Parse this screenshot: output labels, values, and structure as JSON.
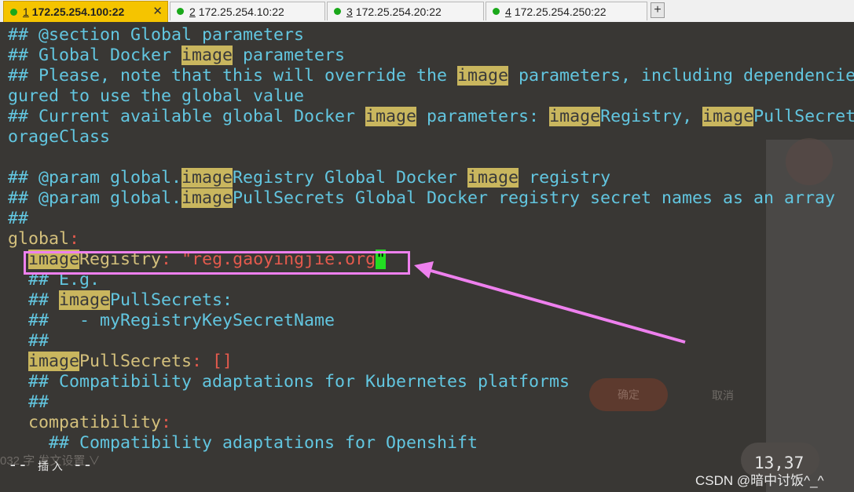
{
  "tabs": [
    {
      "num": "1",
      "label": "172.25.254.100:22",
      "active": true,
      "close": "✕"
    },
    {
      "num": "2",
      "label": "172.25.254.10:22",
      "active": false
    },
    {
      "num": "3",
      "label": "172.25.254.20:22",
      "active": false
    },
    {
      "num": "4",
      "label": "172.25.254.250:22",
      "active": false
    }
  ],
  "add_tab": "+",
  "terminal": {
    "lines": [
      [
        {
          "t": "## @section Global parameters",
          "c": "c"
        }
      ],
      [
        {
          "t": "## Global Docker ",
          "c": "c"
        },
        {
          "t": "image",
          "c": "hl"
        },
        {
          "t": " parameters",
          "c": "c"
        }
      ],
      [
        {
          "t": "## Please, note that this will override the ",
          "c": "c"
        },
        {
          "t": "image",
          "c": "hl"
        },
        {
          "t": " parameters, including dependencie",
          "c": "c"
        }
      ],
      [
        {
          "t": "gured to use the global value",
          "c": "c"
        }
      ],
      [
        {
          "t": "## Current available global Docker ",
          "c": "c"
        },
        {
          "t": "image",
          "c": "hl"
        },
        {
          "t": " parameters: ",
          "c": "c"
        },
        {
          "t": "image",
          "c": "hl"
        },
        {
          "t": "Registry, ",
          "c": "c"
        },
        {
          "t": "image",
          "c": "hl"
        },
        {
          "t": "PullSecret",
          "c": "c"
        }
      ],
      [
        {
          "t": "orageClass",
          "c": "c"
        }
      ],
      [],
      [
        {
          "t": "## @param global.",
          "c": "c"
        },
        {
          "t": "image",
          "c": "hl"
        },
        {
          "t": "Registry Global Docker ",
          "c": "c"
        },
        {
          "t": "image",
          "c": "hl"
        },
        {
          "t": " registry",
          "c": "c"
        }
      ],
      [
        {
          "t": "## @param global.",
          "c": "c"
        },
        {
          "t": "image",
          "c": "hl"
        },
        {
          "t": "PullSecrets Global Docker registry secret names as an array",
          "c": "c"
        }
      ],
      [
        {
          "t": "##",
          "c": "c"
        }
      ],
      [
        {
          "t": "global",
          "c": "y"
        },
        {
          "t": ":",
          "c": "s"
        }
      ],
      [
        {
          "t": "  "
        },
        {
          "t": "image",
          "c": "hl"
        },
        {
          "t": "Registry",
          "c": "y"
        },
        {
          "t": ": ",
          "c": "s"
        },
        {
          "t": "\"reg.gaoyingjie.org",
          "c": "s"
        },
        {
          "t": "\"",
          "c": "cur"
        }
      ],
      [
        {
          "t": "  "
        },
        {
          "t": "## E.g.",
          "c": "c"
        }
      ],
      [
        {
          "t": "  "
        },
        {
          "t": "## ",
          "c": "c"
        },
        {
          "t": "image",
          "c": "hl"
        },
        {
          "t": "PullSecrets:",
          "c": "c"
        }
      ],
      [
        {
          "t": "  "
        },
        {
          "t": "##   - myRegistryKeySecretName",
          "c": "c"
        }
      ],
      [
        {
          "t": "  "
        },
        {
          "t": "##",
          "c": "c"
        }
      ],
      [
        {
          "t": "  "
        },
        {
          "t": "image",
          "c": "hl"
        },
        {
          "t": "PullSecrets",
          "c": "y"
        },
        {
          "t": ": []",
          "c": "s"
        }
      ],
      [
        {
          "t": "  "
        },
        {
          "t": "## Compatibility adaptations for Kubernetes platforms",
          "c": "c"
        }
      ],
      [
        {
          "t": "  "
        },
        {
          "t": "##",
          "c": "c"
        }
      ],
      [
        {
          "t": "  "
        },
        {
          "t": "compatibility",
          "c": "y"
        },
        {
          "t": ":",
          "c": "s"
        }
      ],
      [
        {
          "t": "    "
        },
        {
          "t": "## Compatibility adaptations for Openshift",
          "c": "c"
        }
      ]
    ]
  },
  "status": {
    "prefix": "-- ",
    "mode": "插 入",
    "suffix": " --",
    "position": "13,37"
  },
  "background_ghost": {
    "confirm": "确定",
    "cancel": "取消",
    "bottom": "032 字   发文设置 ∨"
  },
  "watermark": "CSDN @暗中讨饭^_^",
  "colors": {
    "tab_active": "#f5c400",
    "comment": "#62c6e0",
    "key": "#d4c07c",
    "string": "#e55a4d",
    "highlight": "#c9b65e",
    "cursor": "#22dd22",
    "callout": "#ee80ee"
  }
}
